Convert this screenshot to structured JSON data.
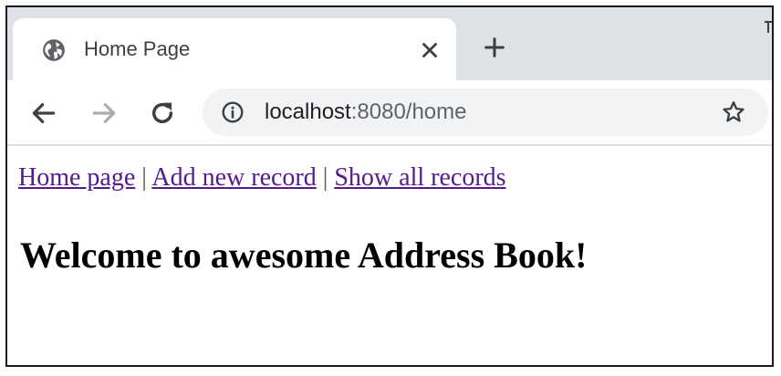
{
  "browser": {
    "tab": {
      "title": "Home Page",
      "favicon": "globe-icon"
    },
    "toolbar": {
      "back_icon": "back-arrow-icon",
      "forward_icon": "forward-arrow-icon",
      "reload_icon": "reload-icon",
      "address": {
        "host": "localhost",
        "rest": ":8080/home",
        "info_icon": "info-icon"
      },
      "bookmark_icon": "star-icon"
    }
  },
  "page": {
    "nav": {
      "links": [
        "Home page",
        "Add new record",
        "Show all records"
      ],
      "separator": "|",
      "link_color": "#551a8b"
    },
    "heading": "Welcome to awesome Address Book!"
  }
}
